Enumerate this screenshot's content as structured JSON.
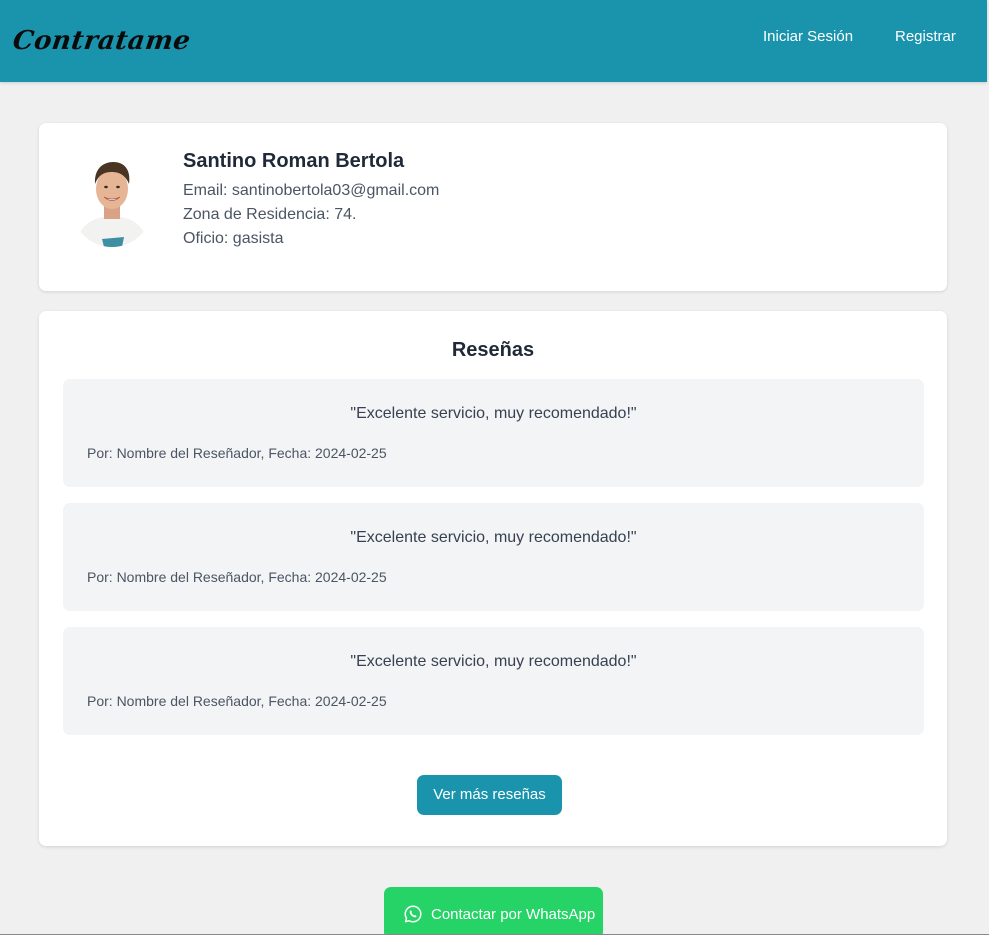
{
  "navbar": {
    "brand": "Contratame",
    "login_label": "Iniciar Sesión",
    "register_label": "Registrar",
    "bg_color": "#1a94ad"
  },
  "profile": {
    "name": "Santino Roman Bertola",
    "email_line": "Email: santinobertola03@gmail.com",
    "zona_line": "Zona de Residencia: 74.",
    "oficio_line": "Oficio: gasista"
  },
  "reviews": {
    "title": "Reseñas",
    "items": [
      {
        "quote": "\"Excelente servicio, muy recomendado!\"",
        "meta": "Por: Nombre del Reseñador, Fecha: 2024-02-25"
      },
      {
        "quote": "\"Excelente servicio, muy recomendado!\"",
        "meta": "Por: Nombre del Reseñador, Fecha: 2024-02-25"
      },
      {
        "quote": "\"Excelente servicio, muy recomendado!\"",
        "meta": "Por: Nombre del Reseñador, Fecha: 2024-02-25"
      }
    ],
    "more_label": "Ver más reseñas"
  },
  "contact": {
    "whatsapp_label": "Contactar por WhatsApp",
    "whatsapp_color": "#25d366"
  }
}
